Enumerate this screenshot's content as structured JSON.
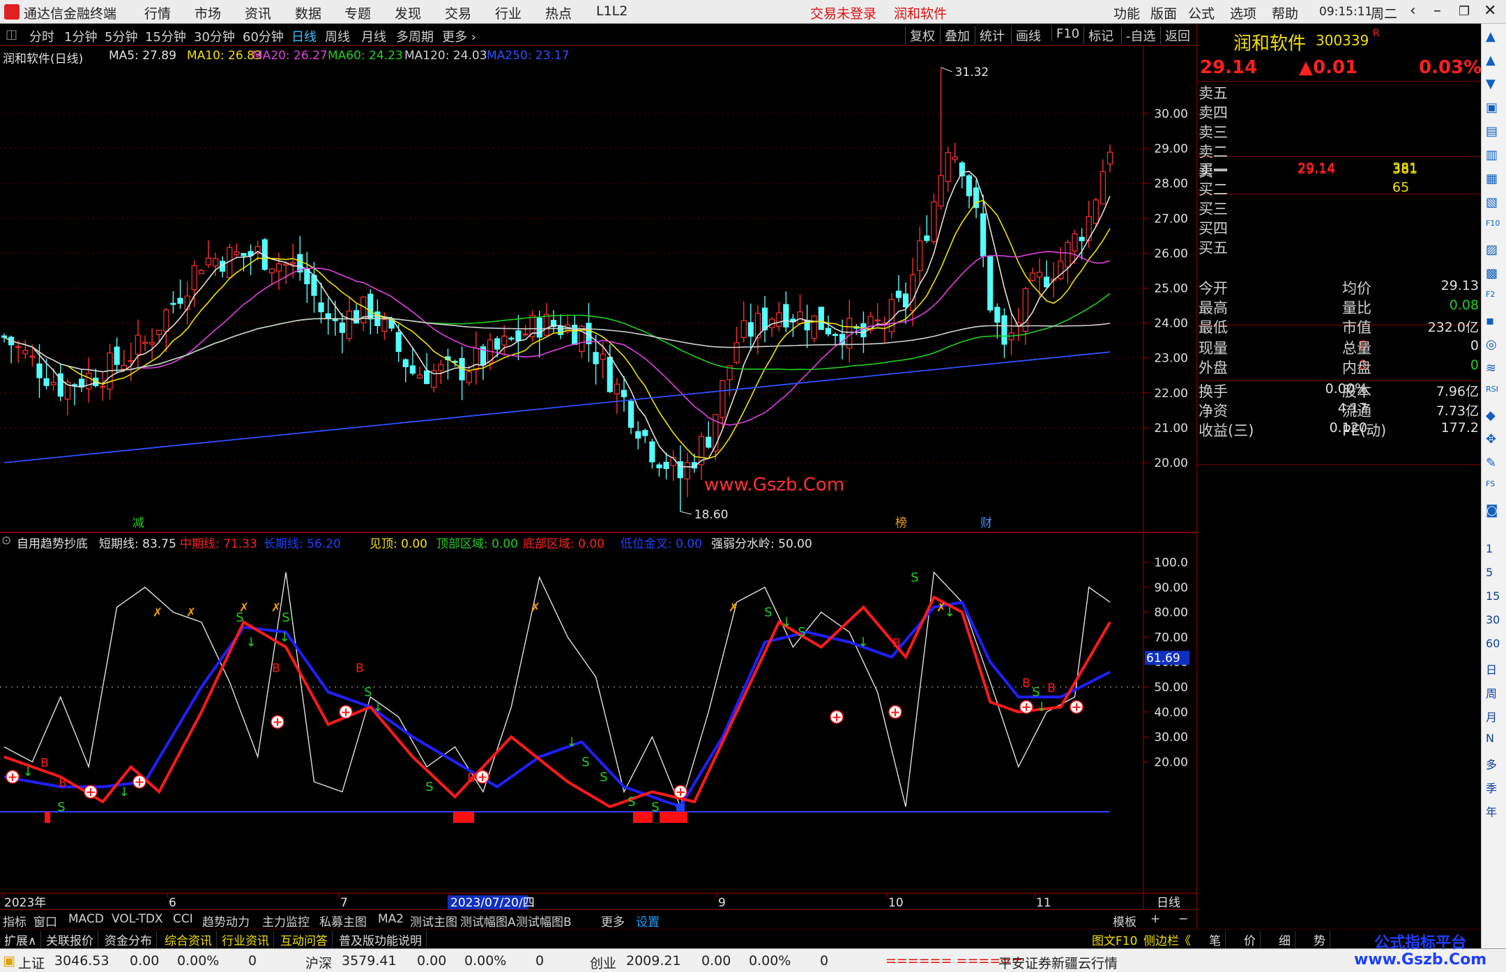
{
  "titlebar": {
    "app": "通达信金融终端",
    "menu": [
      "行情",
      "市场",
      "资讯",
      "数据",
      "专题",
      "发现",
      "交易",
      "行业",
      "热点",
      "L1L2"
    ],
    "login": "交易未登录",
    "stock": "润和软件",
    "right_menu": [
      "功能",
      "版面",
      "公式",
      "选项",
      "帮助"
    ],
    "time": "09:15:11",
    "weekday": "周二"
  },
  "periods": [
    "分时",
    "1分钟",
    "5分钟",
    "15分钟",
    "30分钟",
    "60分钟",
    "日线",
    "周线",
    "月线",
    "多周期",
    "更多"
  ],
  "selected_period": "日线",
  "tools": [
    "复权",
    "叠加",
    "统计",
    "画线",
    "F10",
    "标记",
    "-自选",
    "返回"
  ],
  "ma_legend": {
    "title": "润和软件(日线)",
    "items": [
      {
        "t": "MA5: 27.89",
        "c": "#e0e0e0"
      },
      {
        "t": "MA10: 26.83",
        "c": "#f0e000"
      },
      {
        "t": "MA20: 26.27",
        "c": "#e040e0"
      },
      {
        "t": "MA60: 24.23",
        "c": "#20d020"
      },
      {
        "t": "MA120: 24.03",
        "c": "#d0d0d0"
      },
      {
        "t": "MA250: 23.17",
        "c": "#3050ff"
      }
    ]
  },
  "price_axis": [
    "30.00",
    "29.00",
    "28.00",
    "27.00",
    "26.00",
    "25.00",
    "24.00",
    "23.00",
    "22.00",
    "21.00",
    "20.00"
  ],
  "price_marks": {
    "high": "31.32",
    "low": "18.60"
  },
  "event_labels": [
    "减",
    "榜",
    "财"
  ],
  "indicator_legend": {
    "name": "自用趋势抄底",
    "items": [
      {
        "t": "短期线: 83.75",
        "c": "#e0e0e0"
      },
      {
        "t": "中期线: 71.33",
        "c": "#ff2020"
      },
      {
        "t": "长期线: 56.20",
        "c": "#2040ff"
      },
      {
        "t": "见顶: 0.00",
        "c": "#f0e000"
      },
      {
        "t": "顶部区域: 0.00",
        "c": "#20d020"
      },
      {
        "t": "底部区域: 0.00",
        "c": "#ff2020"
      },
      {
        "t": "低位金叉: 0.00",
        "c": "#2040ff"
      },
      {
        "t": "强弱分水岭: 50.00",
        "c": "#e0e0e0"
      }
    ]
  },
  "ind_axis": [
    "100.0",
    "90.00",
    "80.00",
    "70.00",
    "60.00",
    "50.00",
    "40.00",
    "30.00",
    "20.00"
  ],
  "ind_current": "61.69",
  "date_axis": [
    "2023年",
    "6",
    "7",
    "2023/07/20/四",
    "9",
    "10",
    "11"
  ],
  "date_period": "日线",
  "bottom_tabs": [
    "指标",
    "窗口",
    "MACD",
    "VOL-TDX",
    "CCI",
    "趋势动力",
    "主力监控",
    "私募主图",
    "MA2",
    "测试主图",
    "测试幅图A",
    "测试幅图B",
    "更多",
    "设置"
  ],
  "bottom_right": [
    "模板",
    "+",
    "−"
  ],
  "bottom_tabs2": [
    {
      "t": "扩展∧",
      "c": "#ddd"
    },
    {
      "t": "关联报价",
      "c": "#ddd"
    },
    {
      "t": "资金分布",
      "c": "#ddd"
    },
    {
      "t": "综合资讯",
      "c": "#f0e000"
    },
    {
      "t": "行业资讯",
      "c": "#f0e000"
    },
    {
      "t": "互动问答",
      "c": "#f0e000"
    },
    {
      "t": "普及版功能说明",
      "c": "#ddd"
    }
  ],
  "right_links": [
    "图文F10",
    "侧边栏《"
  ],
  "right_tabs": [
    "笔",
    "价",
    "细",
    "势"
  ],
  "status": {
    "idx": [
      {
        "name": "上证",
        "val": "3046.53",
        "chg": "0.00",
        "pct": "0.00%",
        "vol": "0"
      },
      {
        "name": "沪深",
        "val": "3579.41",
        "chg": "0.00",
        "pct": "0.00%",
        "vol": "0"
      },
      {
        "name": "创业",
        "val": "2009.21",
        "chg": "0.00",
        "pct": "0.00%",
        "vol": "0"
      }
    ],
    "bars": "====== ======",
    "broker": "平安证券新疆云行情"
  },
  "quote": {
    "name": "润和软件",
    "code": "300339",
    "flag": "R",
    "price": "29.14",
    "chg": "▲0.01",
    "pct": "0.03%",
    "sell": [
      {
        "l": "卖五",
        "p": "",
        "v": ""
      },
      {
        "l": "卖四",
        "p": "",
        "v": ""
      },
      {
        "l": "卖三",
        "p": "",
        "v": ""
      },
      {
        "l": "卖二",
        "p": "",
        "v": ""
      },
      {
        "l": "卖一",
        "p": "29.14",
        "v": "381"
      }
    ],
    "buy": [
      {
        "l": "买一",
        "p": "29.14",
        "v": "381"
      },
      {
        "l": "买二",
        "p": "",
        "v": "65"
      },
      {
        "l": "买三",
        "p": "",
        "v": ""
      },
      {
        "l": "买四",
        "p": "",
        "v": ""
      },
      {
        "l": "买五",
        "p": "",
        "v": ""
      }
    ],
    "stats": [
      [
        "今开",
        "",
        "均价",
        "29.13"
      ],
      [
        "最高",
        "",
        "量比",
        "0.08"
      ],
      [
        "最低",
        "",
        "市值",
        "232.0亿"
      ],
      [
        "现量",
        "0",
        "总量",
        "0"
      ],
      [
        "外盘",
        "0",
        "内盘",
        "0"
      ],
      [
        "换手",
        "0.00%",
        "股本",
        "7.96亿"
      ],
      [
        "净资",
        "4.17",
        "流通",
        "7.73亿"
      ],
      [
        "收益(三)",
        "0.120",
        "PE(动)",
        "177.2"
      ]
    ]
  },
  "side_icons": [
    "▲",
    "▲",
    "▼",
    "▣",
    "▤",
    "▥",
    "▦",
    "▧",
    "F10",
    "▨",
    "▩",
    "F2",
    "▪",
    "◎",
    "≋",
    "RSI",
    "◆",
    "✥",
    "✎",
    "FS",
    "◙",
    "1",
    "5",
    "15",
    "30",
    "60",
    "日",
    "周",
    "月",
    "N",
    "多",
    "季",
    "年"
  ],
  "watermark": {
    "line1": "公式指标平台",
    "line2": "www.Gszb.Com"
  },
  "chart_watermark": "www.Gszb.Com"
}
